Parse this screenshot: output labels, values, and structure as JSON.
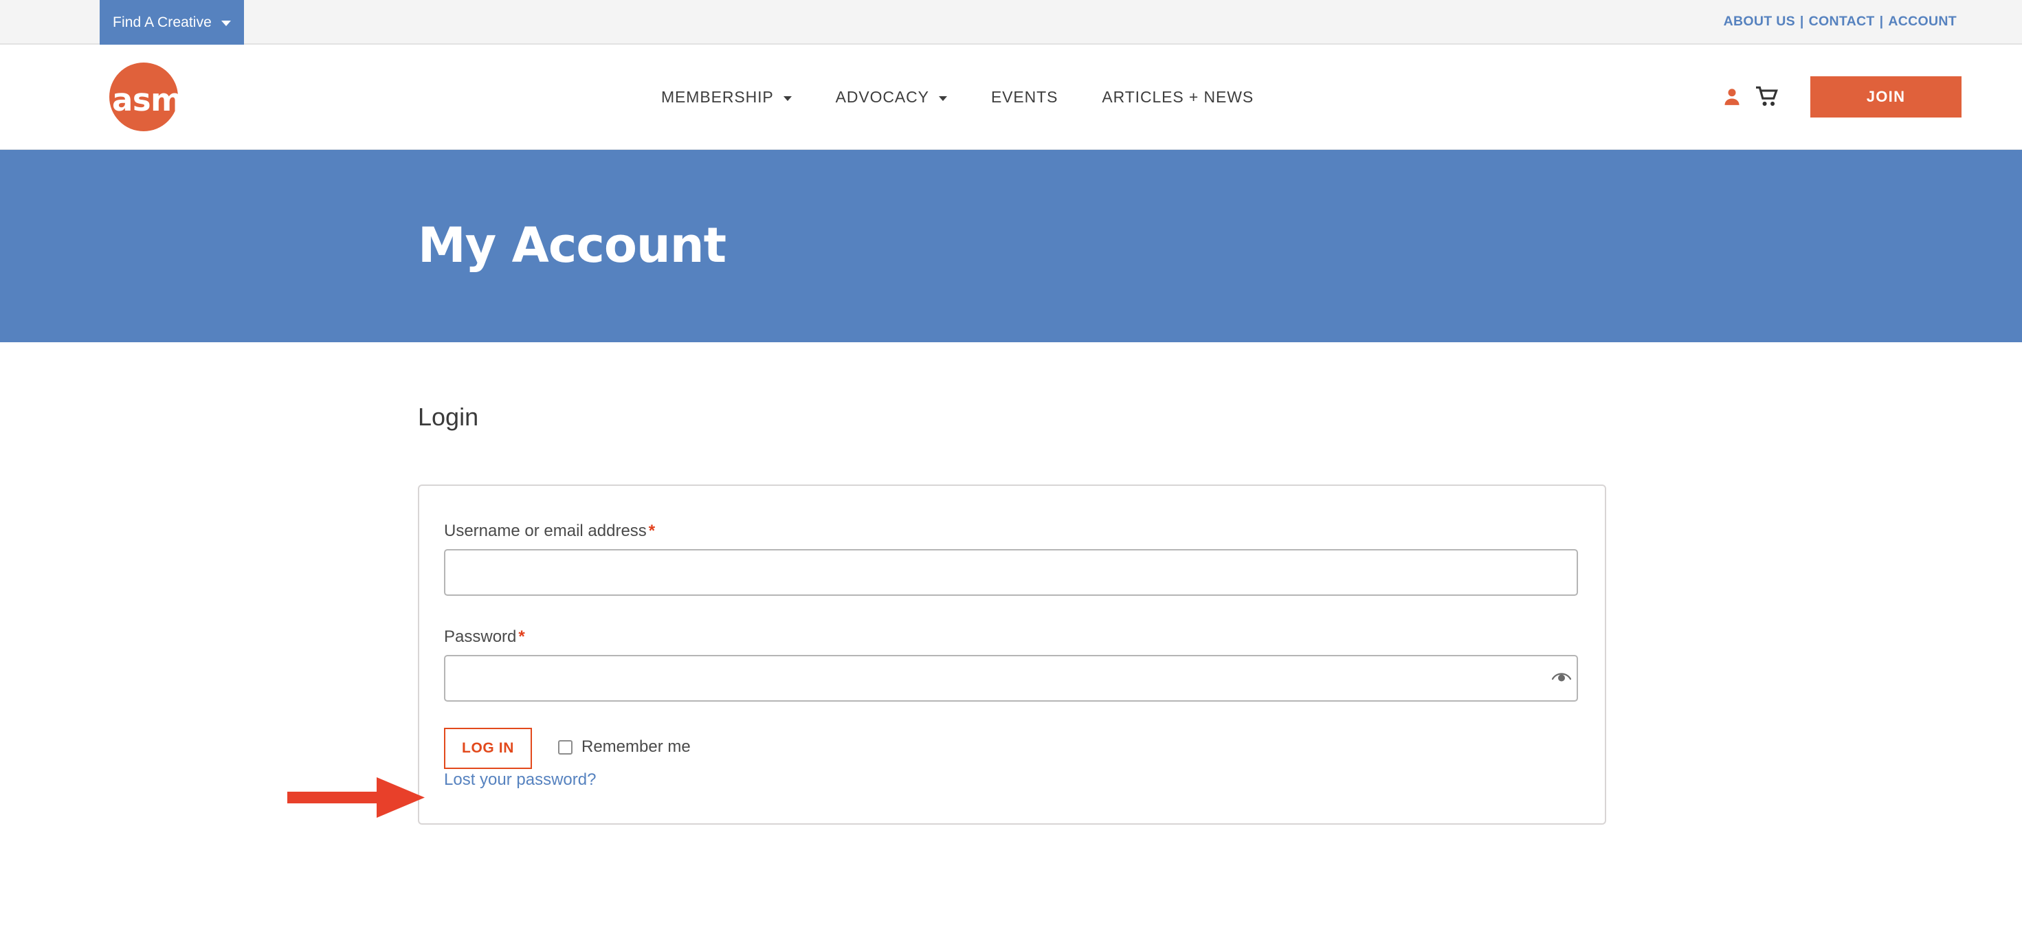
{
  "colors": {
    "brand_orange": "#e0613b",
    "brand_blue": "#5682bf",
    "link_blue": "#5682bf",
    "required_red": "#e2401c",
    "annotation_red": "#e8402a",
    "utility_bar_bg": "#f4f4f4"
  },
  "utility_bar": {
    "find_creative": {
      "label": "Find A Creative",
      "caret_icon": "chevron-down-icon"
    },
    "links": [
      {
        "label": "ABOUT US"
      },
      {
        "label": "CONTACT"
      },
      {
        "label": "ACCOUNT"
      }
    ],
    "separator": "|"
  },
  "header": {
    "logo": {
      "text": "asmp",
      "icon": "asmp-logo-circle"
    },
    "nav": [
      {
        "label": "MEMBERSHIP",
        "has_dropdown": true
      },
      {
        "label": "ADVOCACY",
        "has_dropdown": true
      },
      {
        "label": "EVENTS",
        "has_dropdown": false
      },
      {
        "label": "ARTICLES + NEWS",
        "has_dropdown": false
      }
    ],
    "account_icon": "user-icon",
    "cart_icon": "shopping-cart-icon",
    "join_label": "JOIN"
  },
  "hero": {
    "title": "My Account"
  },
  "main": {
    "heading": "Login",
    "form": {
      "username": {
        "label": "Username or email address",
        "required_mark": "*",
        "value": "",
        "placeholder": ""
      },
      "password": {
        "label": "Password",
        "required_mark": "*",
        "value": "",
        "placeholder": "",
        "toggle_icon": "eye-icon"
      },
      "submit_label": "LOG IN",
      "remember_label": "Remember me",
      "remember_checked": false,
      "lost_password_label": "Lost your password?"
    }
  },
  "annotation": {
    "type": "arrow",
    "direction": "right",
    "points_to": "Lost your password?",
    "color": "#e8402a"
  }
}
